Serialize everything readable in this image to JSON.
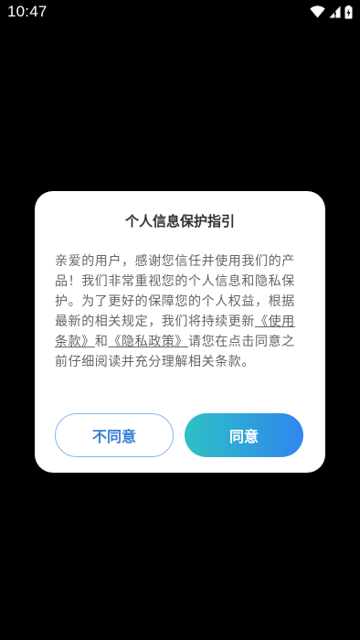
{
  "status_bar": {
    "time": "10:47",
    "icons": [
      "wifi-icon",
      "signal-icon",
      "battery-charging-icon"
    ]
  },
  "dialog": {
    "title": "个人信息保护指引",
    "body_parts": {
      "text_before": "亲爱的用户，感谢您信任并使用我们的产品！我们非常重视您的个人信息和隐私保护。为了更好的保障您的个人权益，根据最新的相关规定，我们将持续更新",
      "terms_link": "《使用条款》",
      "connector": "和",
      "privacy_link": "《隐私政策》",
      "text_after": "请您在点击同意之前仔细阅读并充分理解相关条款。"
    },
    "disagree_label": "不同意",
    "agree_label": "同意"
  },
  "colors": {
    "background": "#000000",
    "dialog_bg": "#ffffff",
    "title": "#333333",
    "body_text": "#666666",
    "disagree_text": "#3a7fd8",
    "disagree_border": "#8db6ec",
    "agree_gradient_start": "#2ec1c6",
    "agree_gradient_end": "#2f86ec"
  }
}
